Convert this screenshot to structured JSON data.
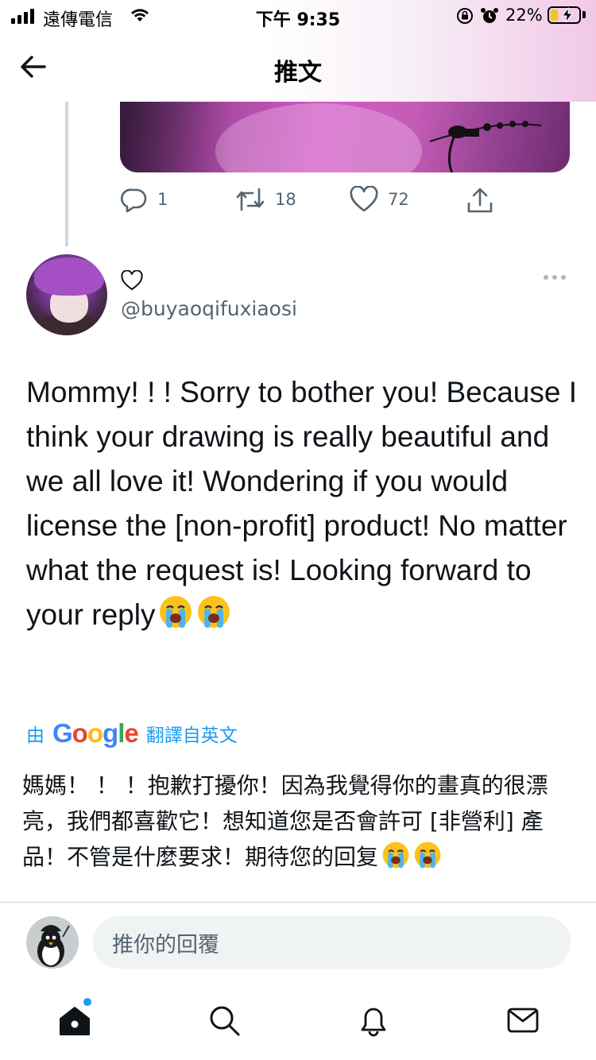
{
  "status_bar": {
    "carrier": "遠傳電信",
    "time": "下午 9:35",
    "battery_percent": "22%",
    "battery_level": 0.22,
    "signal_bars": 4
  },
  "header": {
    "title": "推文",
    "back_icon": "arrow-left-icon"
  },
  "previous_tweet": {
    "actions": {
      "replies": "1",
      "retweets": "18",
      "likes": "72"
    }
  },
  "reply_tweet": {
    "display_name_icon": "heart-outline-icon",
    "handle": "@buyaoqifuxiaosi",
    "text": "Mommy! ! ! Sorry to bother you! Because I think your drawing is really beautiful and we all love it! Wondering if you would license the [non-profit] product! No matter what the request is! Looking forward to your reply",
    "translation_prefix": "由",
    "translation_brand": "Google",
    "translation_suffix": "翻譯自英文",
    "translated_text": "媽媽！ ！ ！抱歉打擾你！因為我覺得你的畫真的很漂亮，我們都喜歡它！想知道您是否會許可 [非營利] 產品！不管是什麼要求！期待您的回复"
  },
  "composer": {
    "placeholder": "推你的回覆"
  },
  "tab_bar": {
    "items": [
      "home-icon",
      "search-icon",
      "notifications-icon",
      "messages-icon"
    ]
  },
  "colors": {
    "accent": "#1d9bf0",
    "text": "#0f1419",
    "secondary_text": "#536471",
    "divider": "#cfd9de",
    "battery_fill": "#f5c518"
  }
}
